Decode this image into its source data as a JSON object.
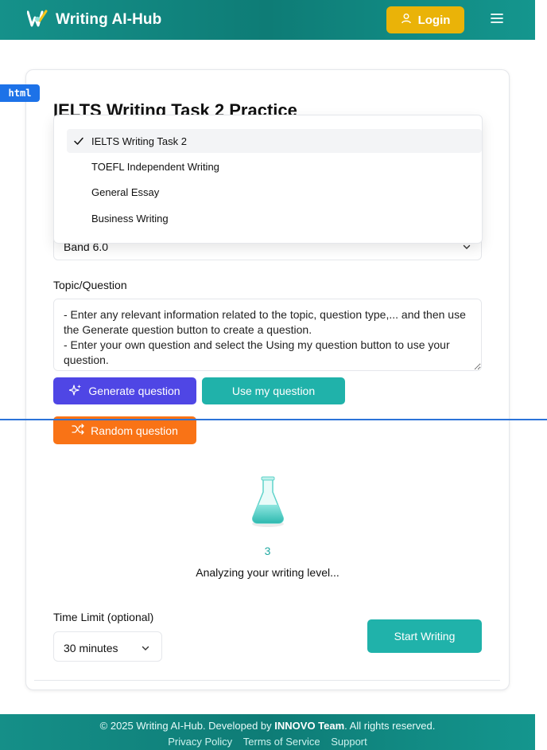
{
  "header": {
    "brand": "Writing AI-Hub",
    "login_label": "Login"
  },
  "html_badge": "html",
  "page_title": "IELTS Writing Task 2 Practice",
  "test_type_dropdown": {
    "options": [
      "IELTS Writing Task 2",
      "TOEFL Independent Writing",
      "General Essay",
      "Business Writing"
    ],
    "selected_index": 0
  },
  "band_select": {
    "value": "Band 6.0"
  },
  "topic": {
    "label": "Topic/Question",
    "placeholder": "- Enter any relevant information related to the topic, question type,... and then use the Generate question button to create a question.\n- Enter your own question and select the Using my question button to use your question."
  },
  "buttons": {
    "generate": "Generate question",
    "use_mine": "Use my question",
    "random": "Random question",
    "start": "Start Writing"
  },
  "analysis": {
    "countdown": "3",
    "message": "Analyzing your writing level..."
  },
  "time_limit": {
    "label": "Time Limit (optional)",
    "value": "30 minutes"
  },
  "footer": {
    "copyright_prefix": "© 2025 Writing AI-Hub. Developed by ",
    "team": "INNOVO Team",
    "copyright_suffix": ". All rights reserved.",
    "links": [
      "Privacy Policy",
      "Terms of Service",
      "Support"
    ]
  },
  "colors": {
    "teal": "#20b2aa",
    "indigo": "#4f46e5",
    "orange": "#f97316",
    "amber": "#eab308"
  }
}
